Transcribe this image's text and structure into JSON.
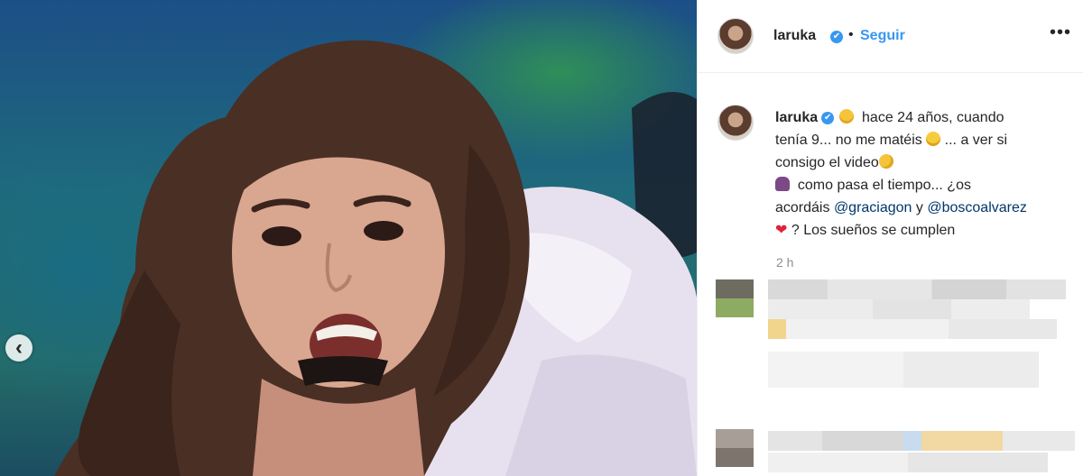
{
  "post": {
    "username": "laruka",
    "verified": true,
    "follow_label": "Seguir",
    "more_label": "•••",
    "separator": "•"
  },
  "caption": {
    "username": "laruka",
    "line1": "hace 24 años, cuando",
    "line2": "tenía 9... no me matéis",
    "line2b": "... a ver si",
    "line3": "consigo el video",
    "line4": "como pasa el tiempo... ¿os",
    "line5a": "acordáis",
    "mention1": "@graciagon",
    "line5b": "y",
    "mention2": "@boscoalvarez",
    "line6": "? Los sueños se cumplen",
    "timestamp": "2 h"
  },
  "icons": {
    "verified": "✔",
    "heart": "❤",
    "prev": "‹"
  },
  "colors": {
    "accent": "#3897f0",
    "mention": "#00376b",
    "text": "#262626",
    "muted": "#8e8e8e"
  }
}
